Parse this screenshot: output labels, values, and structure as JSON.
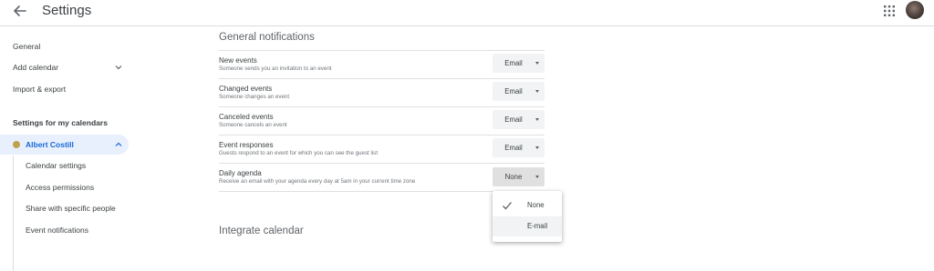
{
  "header": {
    "back_icon": "arrow-left-icon",
    "title": "Settings",
    "apps_icon": "grid-apps-icon"
  },
  "sidebar": {
    "items": [
      {
        "label": "General"
      },
      {
        "label": "Add calendar"
      },
      {
        "label": "Import & export"
      }
    ],
    "my_calendars_heading": "Settings for my calendars",
    "calendar": {
      "name": "Albert Costill",
      "color": "#c0a24a"
    },
    "sub_items": [
      {
        "label": "Calendar settings"
      },
      {
        "label": "Access permissions"
      },
      {
        "label": "Share with specific people"
      },
      {
        "label": "Event notifications"
      }
    ]
  },
  "main": {
    "general_notifications": {
      "title": "General notifications",
      "rows": [
        {
          "title": "New events",
          "description": "Someone sends you an invitation to an event",
          "value": "Email"
        },
        {
          "title": "Changed events",
          "description": "Someone changes an event",
          "value": "Email"
        },
        {
          "title": "Canceled events",
          "description": "Someone cancels an event",
          "value": "Email"
        },
        {
          "title": "Event responses",
          "description": "Guests respond to an event for which you can see the guest list",
          "value": "Email"
        },
        {
          "title": "Daily agenda",
          "description": "Receive an email with your agenda every day at 5am in your current time zone",
          "value": "None"
        }
      ]
    },
    "dropdown_menu": {
      "options": [
        {
          "label": "None",
          "selected": true
        },
        {
          "label": "E-mail",
          "selected": false
        }
      ]
    },
    "integrate_calendar": {
      "title": "Integrate calendar"
    }
  },
  "colors": {
    "accent": "#1967d2",
    "selected_bg": "#e8f0fe",
    "select_bg": "#f1f3f4"
  }
}
